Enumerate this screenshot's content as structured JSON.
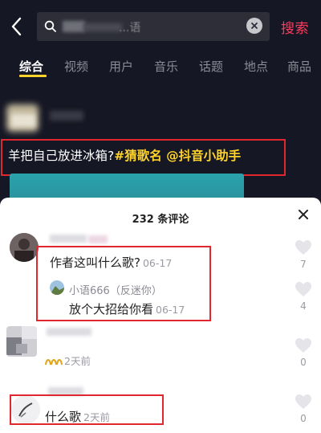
{
  "search": {
    "blurred_value": "...语",
    "button_label": "搜索"
  },
  "tabs": [
    {
      "label": "综合",
      "active": true
    },
    {
      "label": "视频",
      "active": false
    },
    {
      "label": "用户",
      "active": false
    },
    {
      "label": "音乐",
      "active": false
    },
    {
      "label": "话题",
      "active": false
    },
    {
      "label": "地点",
      "active": false
    },
    {
      "label": "商品",
      "active": false
    }
  ],
  "post": {
    "caption_text": "羊把自己放进冰箱?",
    "caption_tags": "#猜歌名 @抖音小助手"
  },
  "comments_panel": {
    "title": "232 条评论",
    "comments": [
      {
        "text": "作者这叫什么歌?",
        "time": "06-17",
        "likes": "7",
        "reply": {
          "user": "小语666（反迷你）",
          "text": "放个大招给你看",
          "time": "06-17",
          "likes": "4"
        }
      },
      {
        "badge": "ccc",
        "time": "2天前",
        "likes": "0"
      },
      {
        "text": "什么歌",
        "time": "2天前",
        "likes": "0"
      }
    ]
  },
  "colors": {
    "accent_red": "#ff3b5c",
    "tag_yellow": "#ffd32b",
    "annotation_red": "#e0262f",
    "dark_bg": "#161724"
  },
  "icons": {
    "back": "chevron-left-icon",
    "search": "search-icon",
    "clear": "clear-icon",
    "close": "close-icon",
    "like": "heart-icon"
  }
}
